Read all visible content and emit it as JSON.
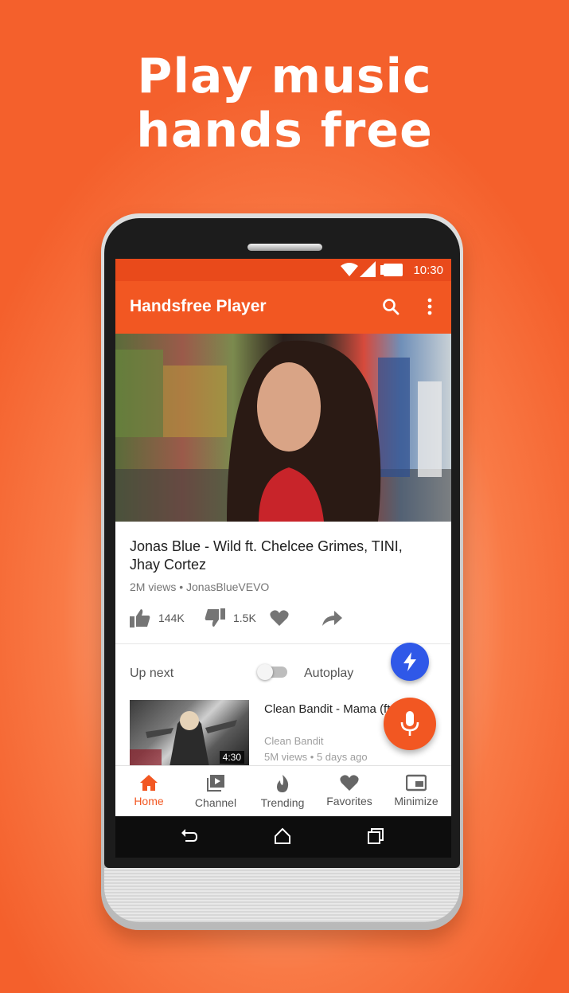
{
  "headline": {
    "line1": "Play music",
    "line2": "hands free"
  },
  "status_bar": {
    "time": "10:30",
    "icons": [
      "wifi-icon",
      "signal-icon",
      "battery-icon"
    ]
  },
  "app_bar": {
    "title": "Handsfree Player",
    "icons": [
      "search-icon",
      "more-vert-icon"
    ]
  },
  "video": {
    "title": "Jonas Blue - Wild ft. Chelcee Grimes, TINI, Jhay Cortez",
    "meta": "2M views • JonasBlueVEVO",
    "likes": "144K",
    "dislikes": "1.5K"
  },
  "up_next": {
    "label": "Up next",
    "autoplay_label": "Autoplay",
    "autoplay_on": false
  },
  "recommended": {
    "title": "Clean Bandit - Mama (ft. Ellie Goulding) [Official",
    "channel": "Clean Bandit",
    "meta": "5M views • 5 days ago",
    "duration": "4:30"
  },
  "bottom_nav": {
    "items": [
      {
        "label": "Home",
        "icon": "home-icon",
        "active": true
      },
      {
        "label": "Channel",
        "icon": "channel-icon",
        "active": false
      },
      {
        "label": "Trending",
        "icon": "flame-icon",
        "active": false
      },
      {
        "label": "Favorites",
        "icon": "heart-icon",
        "active": false
      },
      {
        "label": "Minimize",
        "icon": "minimize-icon",
        "active": false
      }
    ]
  },
  "colors": {
    "accent": "#f25722",
    "status_bar": "#e94a1b",
    "flash_fab": "#2f58e8"
  }
}
